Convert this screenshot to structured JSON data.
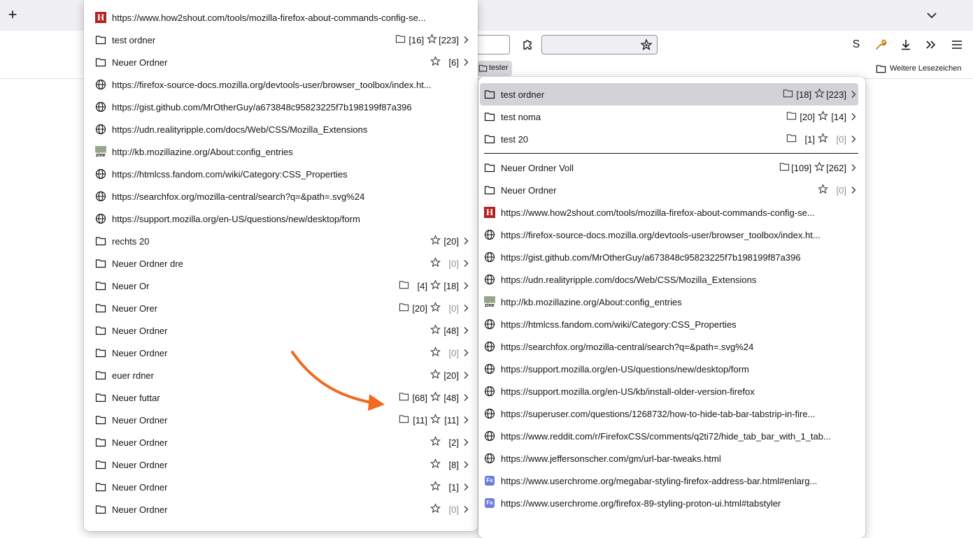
{
  "toolbar": {
    "new_tab": "+",
    "profile_letter": "S",
    "tester_folder": "tester",
    "other_bookmarks": "Weitere Lesezeichen"
  },
  "colors": {
    "accent_arrow": "#f06a22",
    "active_item": "#d3d3d7",
    "wrench": "#c37d14"
  },
  "menu1": [
    {
      "icon": "how2shout-favicon",
      "label": "https://www.how2shout.com/tools/mozilla-firefox-about-commands-config-se..."
    },
    {
      "icon": "folder-icon",
      "label": "test ordner",
      "folders": "[16]",
      "stars": "[223]",
      "submenu": true
    },
    {
      "icon": "folder-icon",
      "label": "Neuer Ordner",
      "stars": "[6]",
      "submenu": true
    },
    {
      "icon": "globe-icon",
      "label": "https://firefox-source-docs.mozilla.org/devtools-user/browser_toolbox/index.ht..."
    },
    {
      "icon": "globe-icon",
      "label": "https://gist.github.com/MrOtherGuy/a673848c95823225f7b198199f87a396"
    },
    {
      "icon": "globe-icon",
      "label": "https://udn.realityripple.com/docs/Web/CSS/Mozilla_Extensions"
    },
    {
      "icon": "mozillazine-favicon",
      "label": "http://kb.mozillazine.org/About:config_entries"
    },
    {
      "icon": "globe-icon",
      "label": "https://htmlcss.fandom.com/wiki/Category:CSS_Properties"
    },
    {
      "icon": "globe-icon",
      "label": "https://searchfox.org/mozilla-central/search?q=&path=.svg%24"
    },
    {
      "icon": "globe-icon",
      "label": "https://support.mozilla.org/en-US/questions/new/desktop/form"
    },
    {
      "icon": "folder-icon",
      "label": "rechts 20",
      "stars": "[20]",
      "submenu": true
    },
    {
      "icon": "folder-icon",
      "label": "Neuer Ordner  dre",
      "stars": "[0]",
      "stars_dim": true,
      "submenu": true
    },
    {
      "icon": "folder-icon",
      "label": "Neuer Or",
      "folders": "[4]",
      "stars": "[18]",
      "submenu": true
    },
    {
      "icon": "folder-icon",
      "label": "Neuer Orer",
      "folders": "[20]",
      "stars": "[0]",
      "stars_dim": true,
      "submenu": true
    },
    {
      "icon": "folder-icon",
      "label": "Neuer Ordner",
      "stars": "[48]",
      "submenu": true
    },
    {
      "icon": "folder-icon",
      "label": "Neuer Ordner",
      "stars": "[0]",
      "stars_dim": true,
      "submenu": true
    },
    {
      "icon": "folder-icon",
      "label": "euer rdner",
      "stars": "[20]",
      "submenu": true
    },
    {
      "icon": "folder-icon",
      "label": "Neuer futtar",
      "folders": "[68]",
      "stars": "[48]",
      "submenu": true
    },
    {
      "icon": "folder-icon",
      "label": "Neuer Ordner",
      "folders": "[11]",
      "stars": "[11]",
      "submenu": true
    },
    {
      "icon": "folder-icon",
      "label": "Neuer Ordner",
      "stars": "[2]",
      "submenu": true
    },
    {
      "icon": "folder-icon",
      "label": "Neuer Ordner",
      "stars": "[8]",
      "submenu": true
    },
    {
      "icon": "folder-icon",
      "label": "Neuer Ordner",
      "stars": "[1]",
      "submenu": true
    },
    {
      "icon": "folder-icon",
      "label": "Neuer Ordner",
      "stars": "[0]",
      "stars_dim": true,
      "submenu": true
    }
  ],
  "menu2": [
    {
      "icon": "folder-icon",
      "label": "test ordner",
      "folders": "[18]",
      "stars": "[223]",
      "submenu": true,
      "active": true
    },
    {
      "icon": "folder-icon",
      "label": "test noma",
      "folders": "[20]",
      "stars": "[14]",
      "submenu": true
    },
    {
      "icon": "folder-icon",
      "label": "test 20",
      "folders": "[1]",
      "stars": "[0]",
      "stars_dim": true,
      "submenu": true
    },
    {
      "separator": true
    },
    {
      "icon": "folder-icon",
      "label": "Neuer Ordner Voll",
      "folders": "[109]",
      "stars": "[262]",
      "submenu": true
    },
    {
      "icon": "folder-icon",
      "label": "Neuer Ordner",
      "stars": "[0]",
      "stars_dim": true,
      "submenu": true
    },
    {
      "icon": "how2shout-favicon",
      "label": "https://www.how2shout.com/tools/mozilla-firefox-about-commands-config-se..."
    },
    {
      "icon": "globe-icon",
      "label": "https://firefox-source-docs.mozilla.org/devtools-user/browser_toolbox/index.ht..."
    },
    {
      "icon": "globe-icon",
      "label": "https://gist.github.com/MrOtherGuy/a673848c95823225f7b198199f87a396"
    },
    {
      "icon": "globe-icon",
      "label": "https://udn.realityripple.com/docs/Web/CSS/Mozilla_Extensions"
    },
    {
      "icon": "mozillazine-favicon",
      "label": "http://kb.mozillazine.org/About:config_entries"
    },
    {
      "icon": "globe-icon",
      "label": "https://htmlcss.fandom.com/wiki/Category:CSS_Properties"
    },
    {
      "icon": "globe-icon",
      "label": "https://searchfox.org/mozilla-central/search?q=&path=.svg%24"
    },
    {
      "icon": "globe-icon",
      "label": "https://support.mozilla.org/en-US/questions/new/desktop/form"
    },
    {
      "icon": "globe-icon",
      "label": "https://support.mozilla.org/en-US/kb/install-older-version-firefox"
    },
    {
      "icon": "globe-icon",
      "label": "https://superuser.com/questions/1268732/how-to-hide-tab-bar-tabstrip-in-fire..."
    },
    {
      "icon": "globe-icon",
      "label": "https://www.reddit.com/r/FirefoxCSS/comments/q2ti72/hide_tab_bar_with_1_tab..."
    },
    {
      "icon": "globe-icon",
      "label": "https://www.jeffersonscher.com/gm/url-bar-tweaks.html"
    },
    {
      "icon": "userchrome-favicon",
      "label": "https://www.userchrome.org/megabar-styling-firefox-address-bar.html#enlarg..."
    },
    {
      "icon": "userchrome-favicon",
      "label": "https://www.userchrome.org/firefox-89-styling-proton-ui.html#tabstyler"
    }
  ]
}
